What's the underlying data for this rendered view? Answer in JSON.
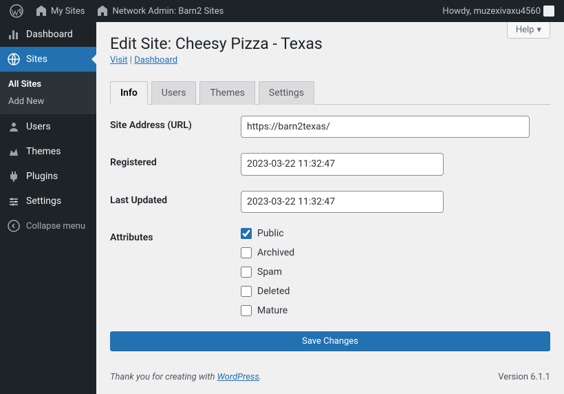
{
  "admin_bar": {
    "my_sites": "My Sites",
    "network_admin": "Network Admin: Barn2 Sites",
    "howdy": "Howdy, muzexivaxu4560"
  },
  "sidebar": {
    "dashboard": "Dashboard",
    "sites": "Sites",
    "sites_sub": {
      "all": "All Sites",
      "add": "Add New"
    },
    "users": "Users",
    "themes": "Themes",
    "plugins": "Plugins",
    "settings": "Settings",
    "collapse": "Collapse menu"
  },
  "help": "Help",
  "heading": "Edit Site: Cheesy Pizza - Texas",
  "subnav": {
    "visit": "Visit",
    "dashboard": "Dashboard"
  },
  "tabs": {
    "info": "Info",
    "users": "Users",
    "themes": "Themes",
    "settings": "Settings"
  },
  "form": {
    "url_label": "Site Address (URL)",
    "url_value": "https://barn2texas/",
    "registered_label": "Registered",
    "registered_value": "2023-03-22 11:32:47",
    "updated_label": "Last Updated",
    "updated_value": "2023-03-22 11:32:47",
    "attributes_label": "Attributes",
    "attributes": {
      "public": "Public",
      "archived": "Archived",
      "spam": "Spam",
      "deleted": "Deleted",
      "mature": "Mature"
    },
    "save": "Save Changes"
  },
  "footer": {
    "thanks": "Thank you for creating with ",
    "wp": "WordPress",
    "version": "Version 6.1.1"
  }
}
